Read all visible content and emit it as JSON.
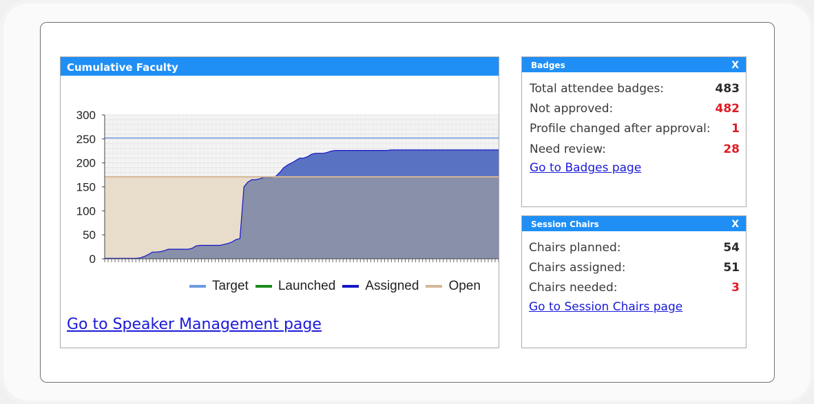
{
  "faculty": {
    "title": "Cumulative Faculty",
    "link": "Go to Speaker Management page"
  },
  "badges": {
    "title": "Badges",
    "close": "X",
    "rows": [
      {
        "label": "Total attendee badges:",
        "value": "483",
        "color": "#2a2a2a"
      },
      {
        "label": "Not approved:",
        "value": "482",
        "color": "#e01b24"
      },
      {
        "label": "Profile changed after approval:",
        "value": "1",
        "color": "#e01b24"
      },
      {
        "label": "Need review:",
        "value": "28",
        "color": "#e01b24"
      }
    ],
    "link": "Go to Badges page"
  },
  "chairs": {
    "title": "Session Chairs",
    "close": "X",
    "rows": [
      {
        "label": "Chairs planned:",
        "value": "54",
        "color": "#2a2a2a"
      },
      {
        "label": "Chairs assigned:",
        "value": "51",
        "color": "#2a2a2a"
      },
      {
        "label": "Chairs needed:",
        "value": "3",
        "color": "#e01b24"
      }
    ],
    "link": "Go to Session Chairs page"
  },
  "chart_data": {
    "type": "area",
    "title": "",
    "xlabel": "",
    "ylabel": "",
    "ylim": [
      0,
      300
    ],
    "yticks": [
      0,
      50,
      100,
      150,
      200,
      250,
      300
    ],
    "grid": true,
    "legend_position": "bottom",
    "x_points": 100,
    "series": [
      {
        "name": "Target",
        "color": "#6a9be0",
        "kind": "line",
        "values": [
          252
        ]
      },
      {
        "name": "Launched",
        "color": "#1a8a1a",
        "kind": "line",
        "values": []
      },
      {
        "name": "Assigned",
        "color": "#1414c8",
        "kind": "area",
        "values": [
          1,
          1,
          1,
          1,
          1,
          1,
          1,
          1,
          1,
          2,
          5,
          9,
          14,
          14,
          15,
          17,
          20,
          20,
          20,
          20,
          20,
          20,
          22,
          27,
          28,
          28,
          28,
          28,
          28,
          28,
          30,
          32,
          35,
          40,
          42,
          150,
          160,
          165,
          165,
          167,
          170,
          170,
          170,
          172,
          180,
          190,
          196,
          200,
          205,
          210,
          210,
          213,
          218,
          220,
          220,
          220,
          222,
          225,
          226,
          226,
          226,
          226,
          226,
          226,
          226,
          226,
          226,
          226,
          226,
          226,
          226,
          226,
          227,
          227,
          227,
          227,
          227,
          227,
          227,
          227,
          227,
          227,
          227,
          227,
          227,
          227,
          227,
          227,
          227,
          227,
          227,
          227,
          227,
          227,
          227,
          227,
          227,
          227,
          227,
          227
        ]
      },
      {
        "name": "Open",
        "color": "#d4b896",
        "kind": "line",
        "values": [
          171
        ]
      }
    ]
  }
}
